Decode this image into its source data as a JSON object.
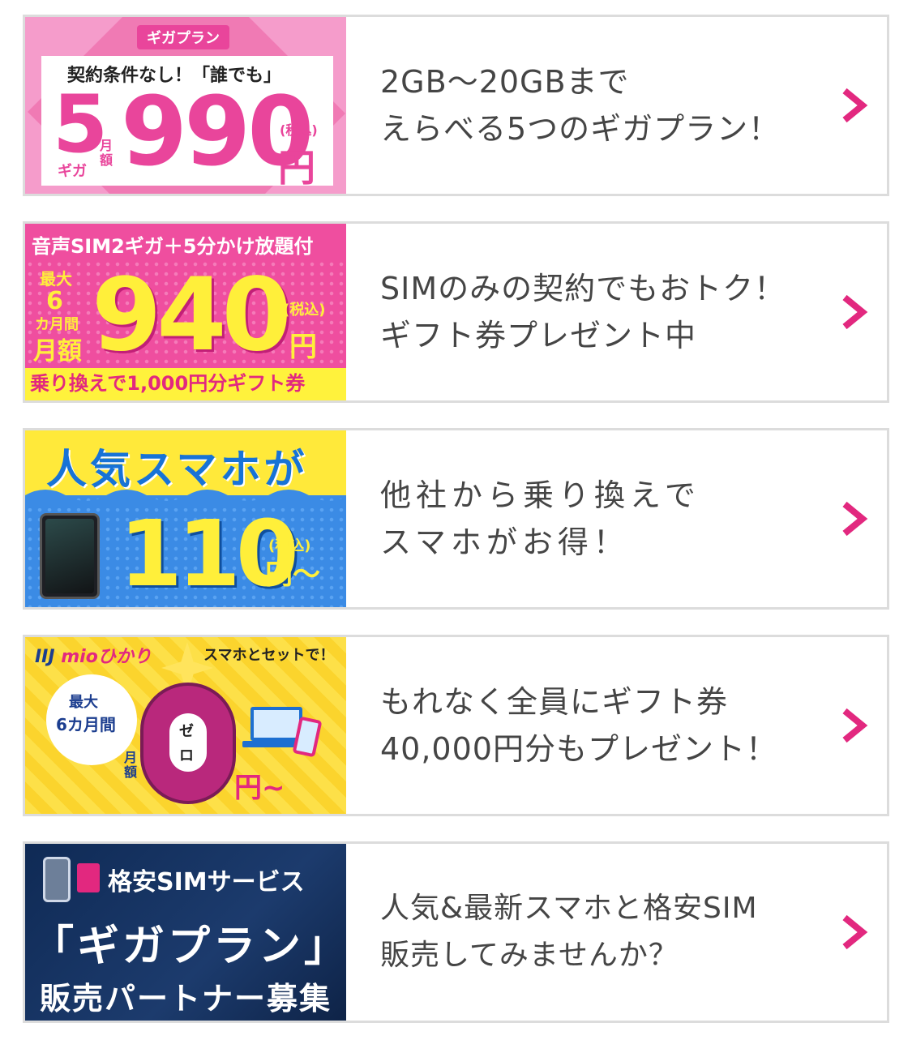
{
  "colors": {
    "chevron": "#e2287f",
    "card_border": "#dcdcdc",
    "text": "#454545"
  },
  "cards": [
    {
      "banner": {
        "tag": "ギガプラン",
        "subtitle": "契約条件なし！「誰でも」",
        "giga_num": "5",
        "giga_unit": "ギガ",
        "monthly": "月額",
        "price": "990",
        "yen": "円",
        "tax": "(税込)"
      },
      "lines": [
        "2GB〜20GBまで",
        "えらべる5つのギガプラン！"
      ],
      "icon": "chevron-right-icon"
    },
    {
      "banner": {
        "head": "音声SIM2ギガ＋5分かけ放題付",
        "max": "最大",
        "six": "6",
        "months": "カ月間",
        "monthly": "月額",
        "price": "940",
        "tax": "(税込)",
        "yen": "円",
        "footer": "乗り換えで1,000円分ギフト券"
      },
      "lines": [
        "SIMのみの契約でもおトク！",
        "ギフト券プレゼント中"
      ],
      "icon": "chevron-right-icon"
    },
    {
      "banner": {
        "title": "人気スマホが",
        "price": "110",
        "tax": "(税込)",
        "yen": "円〜"
      },
      "lines": [
        "他社から乗り換えで",
        "スマホがお得！"
      ],
      "icon": "chevron-right-icon"
    },
    {
      "banner": {
        "logo_a": "IIJ",
        "logo_b": "mioひかり",
        "set": "スマホとセットで！",
        "max": "最大",
        "months": "6カ月間",
        "zero_a": "ゼ",
        "zero_b": "ロ",
        "monthly": "月額",
        "yen": "円~"
      },
      "lines": [
        "もれなく全員にギフト券",
        "40,000円分もプレゼント！"
      ],
      "icon": "chevron-right-icon"
    },
    {
      "banner": {
        "line1": "格安SIMサービス",
        "line2": "「ギガプラン」",
        "line3": "販売パートナー募集"
      },
      "lines": [
        "人気&最新スマホと格安SIM",
        "販売してみませんか？"
      ],
      "icon": "chevron-right-icon"
    }
  ]
}
